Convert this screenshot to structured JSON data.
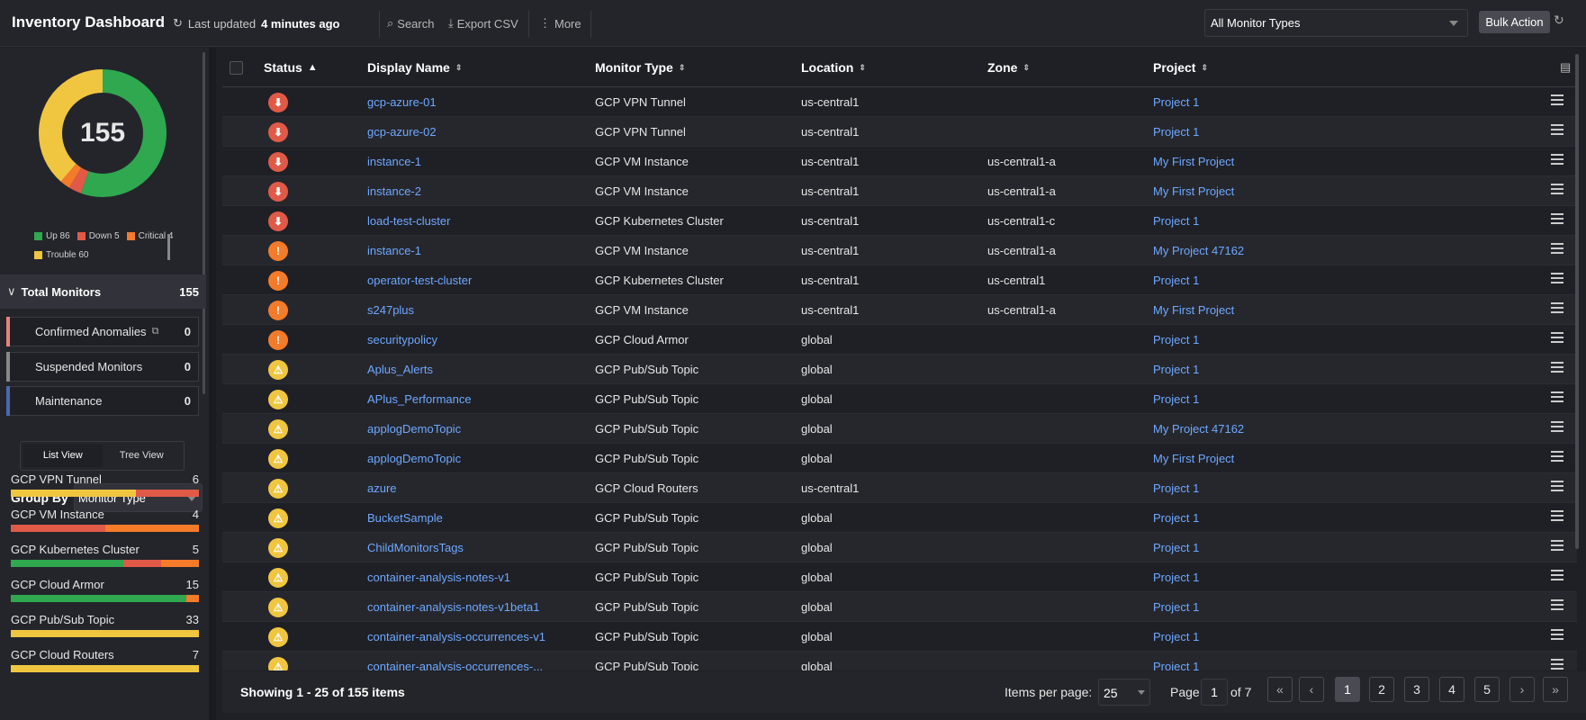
{
  "header": {
    "title": "Inventory Dashboard",
    "last_updated_prefix": "Last updated",
    "last_updated_value": "4 minutes ago",
    "search_label": "Search",
    "export_label": "Export CSV",
    "more_label": "More",
    "monitor_type_filter": "All Monitor Types",
    "bulk_action_label": "Bulk Action"
  },
  "summary": {
    "total": "155",
    "legend": [
      {
        "label": "Up 86",
        "color": "#2fa84f"
      },
      {
        "label": "Down 5",
        "color": "#e05a47"
      },
      {
        "label": "Critical 4",
        "color": "#f47b2a"
      },
      {
        "label": "Trouble 60",
        "color": "#f0c640"
      }
    ],
    "donut": {
      "up": 86,
      "down": 5,
      "critical": 4,
      "trouble": 60
    },
    "total_monitors_label": "Total Monitors",
    "total_monitors_count": "155",
    "confirmed_anomalies_label": "Confirmed Anomalies",
    "confirmed_anomalies_count": "0",
    "suspended_label": "Suspended Monitors",
    "suspended_count": "0",
    "maintenance_label": "Maintenance",
    "maintenance_count": "0"
  },
  "view": {
    "list_label": "List View",
    "tree_label": "Tree View"
  },
  "group_by": {
    "label": "Group By",
    "selected": "Monitor Type",
    "groups": [
      {
        "name": "GCP VPN Tunnel",
        "count": "6",
        "segments": [
          {
            "color": "#f0c640",
            "value": 4
          },
          {
            "color": "#e05a47",
            "value": 2
          }
        ]
      },
      {
        "name": "GCP VM Instance",
        "count": "4",
        "segments": [
          {
            "color": "#e05a47",
            "value": 2
          },
          {
            "color": "#f47b2a",
            "value": 2
          }
        ]
      },
      {
        "name": "GCP Kubernetes Cluster",
        "count": "5",
        "segments": [
          {
            "color": "#2fa84f",
            "value": 3
          },
          {
            "color": "#e05a47",
            "value": 1
          },
          {
            "color": "#f47b2a",
            "value": 1
          }
        ]
      },
      {
        "name": "GCP Cloud Armor",
        "count": "15",
        "segments": [
          {
            "color": "#2fa84f",
            "value": 14
          },
          {
            "color": "#f47b2a",
            "value": 1
          }
        ]
      },
      {
        "name": "GCP Pub/Sub Topic",
        "count": "33",
        "segments": [
          {
            "color": "#f0c640",
            "value": 33
          }
        ]
      },
      {
        "name": "GCP Cloud Routers",
        "count": "7",
        "segments": [
          {
            "color": "#f0c640",
            "value": 7
          }
        ]
      }
    ]
  },
  "table": {
    "columns": [
      "Status",
      "Display Name",
      "Monitor Type",
      "Location",
      "Zone",
      "Project"
    ],
    "rows": [
      {
        "status": "down",
        "name": "gcp-azure-01",
        "type": "GCP VPN Tunnel",
        "location": "us-central1",
        "zone": "",
        "project": "Project 1"
      },
      {
        "status": "down",
        "name": "gcp-azure-02",
        "type": "GCP VPN Tunnel",
        "location": "us-central1",
        "zone": "",
        "project": "Project 1"
      },
      {
        "status": "down",
        "name": "instance-1",
        "type": "GCP VM Instance",
        "location": "us-central1",
        "zone": "us-central1-a",
        "project": "My First Project"
      },
      {
        "status": "down",
        "name": "instance-2",
        "type": "GCP VM Instance",
        "location": "us-central1",
        "zone": "us-central1-a",
        "project": "My First Project"
      },
      {
        "status": "down",
        "name": "load-test-cluster",
        "type": "GCP Kubernetes Cluster",
        "location": "us-central1",
        "zone": "us-central1-c",
        "project": "Project 1"
      },
      {
        "status": "critical",
        "name": "instance-1",
        "type": "GCP VM Instance",
        "location": "us-central1",
        "zone": "us-central1-a",
        "project": "My Project 47162"
      },
      {
        "status": "critical",
        "name": "operator-test-cluster",
        "type": "GCP Kubernetes Cluster",
        "location": "us-central1",
        "zone": "us-central1",
        "project": "Project 1"
      },
      {
        "status": "critical",
        "name": "s247plus",
        "type": "GCP VM Instance",
        "location": "us-central1",
        "zone": "us-central1-a",
        "project": "My First Project"
      },
      {
        "status": "critical",
        "name": "securitypolicy",
        "type": "GCP Cloud Armor",
        "location": "global",
        "zone": "",
        "project": "Project 1"
      },
      {
        "status": "trouble",
        "name": "Aplus_Alerts",
        "type": "GCP Pub/Sub Topic",
        "location": "global",
        "zone": "",
        "project": "Project 1"
      },
      {
        "status": "trouble",
        "name": "APlus_Performance",
        "type": "GCP Pub/Sub Topic",
        "location": "global",
        "zone": "",
        "project": "Project 1"
      },
      {
        "status": "trouble",
        "name": "applogDemoTopic",
        "type": "GCP Pub/Sub Topic",
        "location": "global",
        "zone": "",
        "project": "My Project 47162"
      },
      {
        "status": "trouble",
        "name": "applogDemoTopic",
        "type": "GCP Pub/Sub Topic",
        "location": "global",
        "zone": "",
        "project": "My First Project"
      },
      {
        "status": "trouble",
        "name": "azure",
        "type": "GCP Cloud Routers",
        "location": "us-central1",
        "zone": "",
        "project": "Project 1"
      },
      {
        "status": "trouble",
        "name": "BucketSample",
        "type": "GCP Pub/Sub Topic",
        "location": "global",
        "zone": "",
        "project": "Project 1"
      },
      {
        "status": "trouble",
        "name": "ChildMonitorsTags",
        "type": "GCP Pub/Sub Topic",
        "location": "global",
        "zone": "",
        "project": "Project 1"
      },
      {
        "status": "trouble",
        "name": "container-analysis-notes-v1",
        "type": "GCP Pub/Sub Topic",
        "location": "global",
        "zone": "",
        "project": "Project 1"
      },
      {
        "status": "trouble",
        "name": "container-analysis-notes-v1beta1",
        "type": "GCP Pub/Sub Topic",
        "location": "global",
        "zone": "",
        "project": "Project 1"
      },
      {
        "status": "trouble",
        "name": "container-analysis-occurrences-v1",
        "type": "GCP Pub/Sub Topic",
        "location": "global",
        "zone": "",
        "project": "Project 1"
      },
      {
        "status": "trouble",
        "name": "container-analysis-occurrences-...",
        "type": "GCP Pub/Sub Topic",
        "location": "global",
        "zone": "",
        "project": "Project 1"
      }
    ]
  },
  "pagination": {
    "showing": "Showing 1 - 25 of 155 items",
    "items_per_page_label": "Items per page:",
    "items_per_page": "25",
    "page_label": "Page",
    "page_value": "1",
    "of_label": "of 7",
    "first": "«",
    "prev": "‹",
    "pages": [
      "1",
      "2",
      "3",
      "4",
      "5"
    ],
    "next": "›",
    "last": "»"
  },
  "status_colors": {
    "up": "#2fa84f",
    "down": "#e05a47",
    "critical": "#f47b2a",
    "trouble": "#f0c640"
  }
}
